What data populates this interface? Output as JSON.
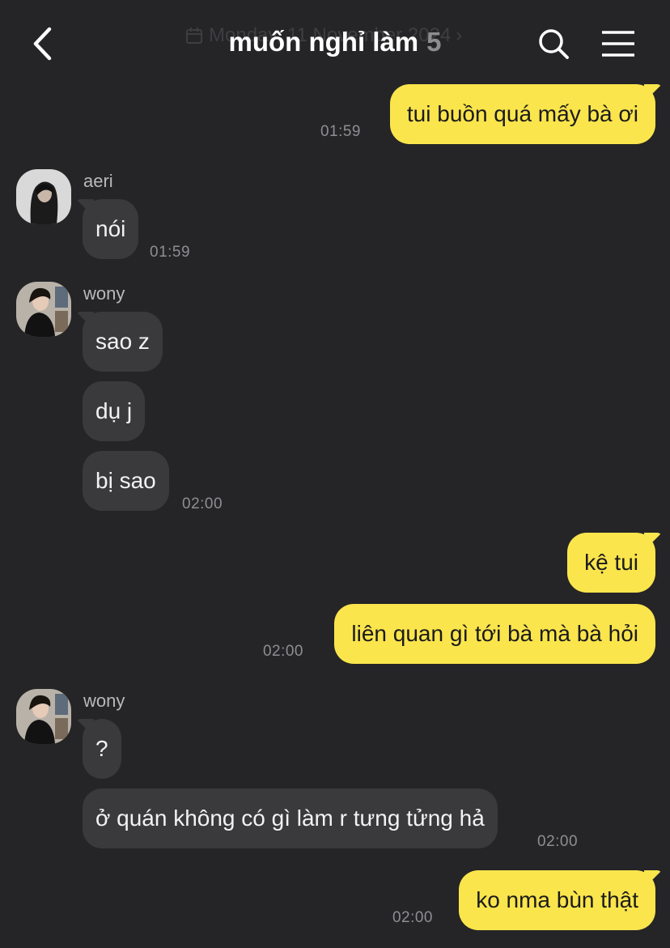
{
  "header": {
    "title": "muốn nghỉ làm",
    "member_count": "5",
    "date_ghost": "Monday, 11 November 2024"
  },
  "messages": [
    {
      "side": "mine",
      "text": "tui buồn quá mấy bà ơi",
      "time": "01:59"
    },
    {
      "side": "theirs",
      "sender": "aeri",
      "text": "nói",
      "time": "01:59"
    },
    {
      "side": "theirs",
      "sender": "wony",
      "text": "sao z"
    },
    {
      "side": "theirs",
      "text": "dụ j"
    },
    {
      "side": "theirs",
      "text": "bị sao",
      "time": "02:00"
    },
    {
      "side": "mine",
      "text": "kệ tui"
    },
    {
      "side": "mine",
      "text": "liên quan gì tới bà mà bà hỏi",
      "time": "02:00"
    },
    {
      "side": "theirs",
      "sender": "wony",
      "text": "?"
    },
    {
      "side": "theirs",
      "text": "ở quán không có gì làm r tưng tửng hả",
      "time": "02:00"
    },
    {
      "side": "mine",
      "text": "ko nma bùn thật",
      "time": "02:00"
    }
  ],
  "colors": {
    "background": "#252527",
    "my_bubble": "#fbe54d",
    "their_bubble": "#3a3a3d"
  },
  "icons": {
    "back": "chevron-left-icon",
    "search": "search-icon",
    "menu": "hamburger-menu-icon",
    "calendar": "calendar-icon"
  }
}
